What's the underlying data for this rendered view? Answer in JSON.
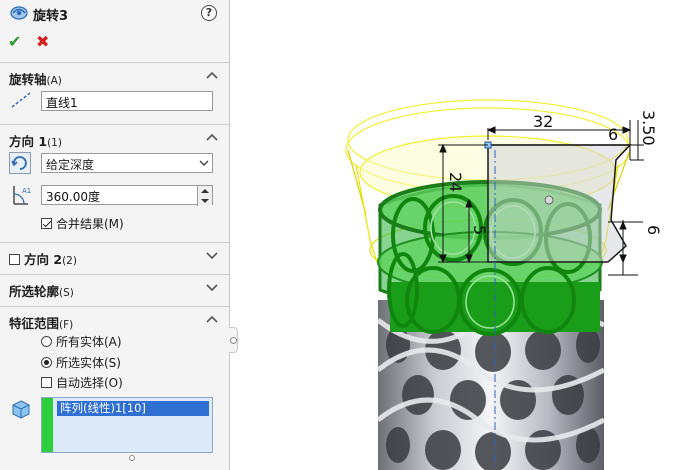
{
  "panel": {
    "title": "旋转3",
    "help_label": "?",
    "ok_label": "✔",
    "cancel_label": "✖"
  },
  "axis_section": {
    "header": "旋转轴",
    "header_suffix": "(A)",
    "axis_value": "直线1"
  },
  "direction1": {
    "header": "方向 1",
    "header_suffix": "(1)",
    "end_condition": "给定深度",
    "angle_value": "360.00度",
    "merge_label": "合并结果(M)",
    "merge_checked": true
  },
  "direction2": {
    "header": "方向 2",
    "header_suffix": "(2)",
    "enabled": false
  },
  "selected_contours": {
    "header": "所选轮廓",
    "header_suffix": "(S)"
  },
  "feature_scope": {
    "header": "特征范围",
    "header_suffix": "(F)",
    "all_bodies_label": "所有实体(A)",
    "selected_bodies_label": "所选实体(S)",
    "selected_bodies_checked": true,
    "auto_select_label": "自动选择(O)",
    "auto_select_checked": false,
    "bodies_list": [
      "阵列(线性)1[10]"
    ]
  },
  "sketch_dimensions": [
    "32",
    "6",
    "3.50",
    "24",
    "5",
    "6"
  ],
  "colors": {
    "panel_bg": "#f4f4f4",
    "ok_green": "#2e9a2e",
    "cancel_red": "#d42020",
    "selection_blue": "#2f6fd1",
    "body_green": "#1a9e1a",
    "preview_yellow": "#f2f000"
  }
}
